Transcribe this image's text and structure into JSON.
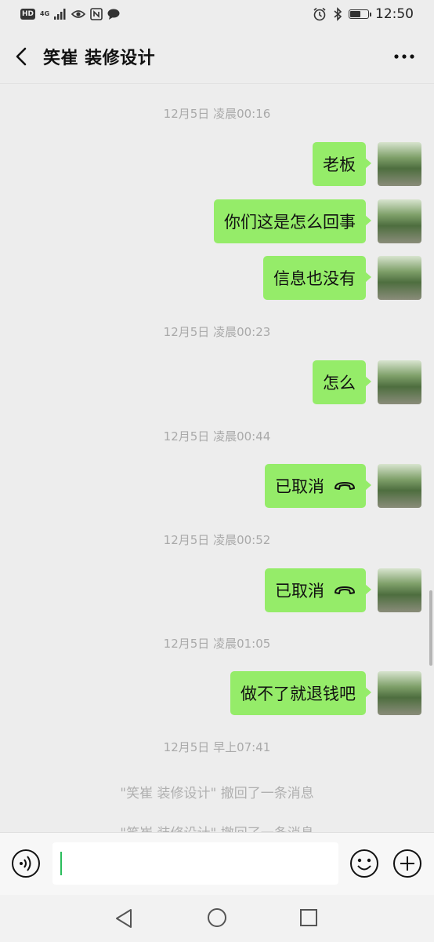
{
  "status_bar": {
    "hd": "HD",
    "network": "4G",
    "time": "12:50",
    "battery_level": 0.6
  },
  "header": {
    "title": "笑崔 装修设计",
    "back_icon": "chevron-left-icon",
    "more_icon": "more-dots-icon"
  },
  "messages": [
    {
      "type": "timestamp",
      "text": "12月5日 凌晨00:16"
    },
    {
      "type": "sent",
      "text": "老板"
    },
    {
      "type": "sent",
      "text": "你们这是怎么回事"
    },
    {
      "type": "sent",
      "text": "信息也没有"
    },
    {
      "type": "timestamp",
      "text": "12月5日 凌晨00:23"
    },
    {
      "type": "sent",
      "text": "怎么"
    },
    {
      "type": "timestamp",
      "text": "12月5日 凌晨00:44"
    },
    {
      "type": "call",
      "text": "已取消",
      "icon": "phone-hangup-icon"
    },
    {
      "type": "timestamp",
      "text": "12月5日 凌晨00:52"
    },
    {
      "type": "call",
      "text": "已取消",
      "icon": "phone-hangup-icon"
    },
    {
      "type": "timestamp",
      "text": "12月5日 凌晨01:05"
    },
    {
      "type": "sent",
      "text": "做不了就退钱吧"
    },
    {
      "type": "timestamp",
      "text": "12月5日 早上07:41"
    },
    {
      "type": "system",
      "text": "\"笑崔 装修设计\" 撤回了一条消息"
    },
    {
      "type": "system",
      "text": "\"笑崔 装修设计\" 撤回了一条消息"
    }
  ],
  "input_bar": {
    "voice_icon": "voice-icon",
    "emoji_icon": "emoji-icon",
    "plus_icon": "plus-icon",
    "value": ""
  },
  "nav_bar": {
    "back_icon": "nav-back-icon",
    "home_icon": "nav-home-icon",
    "recent_icon": "nav-recent-icon"
  }
}
